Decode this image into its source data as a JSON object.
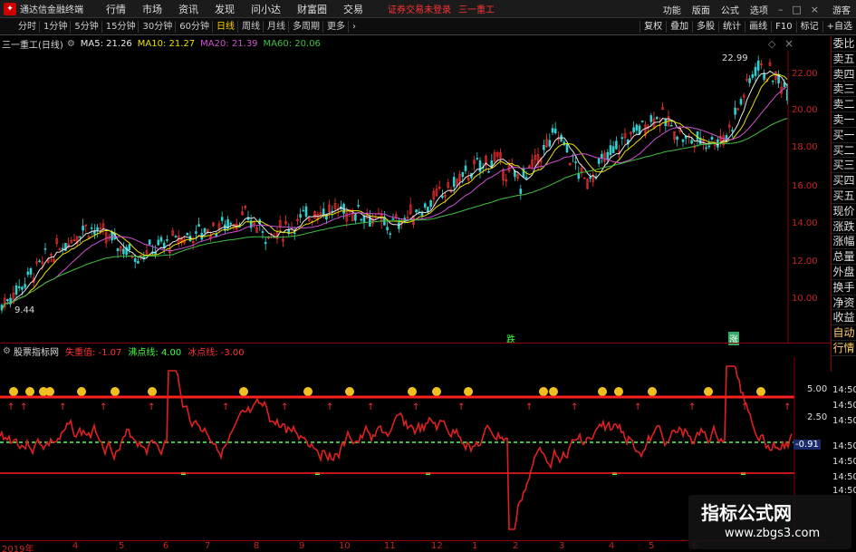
{
  "app": {
    "title": "通达信金融终端",
    "menu": [
      "行情",
      "市场",
      "资讯",
      "发现",
      "问小达",
      "财富圈",
      "交易"
    ],
    "broker_status": "证券交易未登录",
    "stock_title": "三一重工",
    "right_menu": [
      "功能",
      "版面",
      "公式",
      "选项"
    ],
    "guest": "游客"
  },
  "toolbar": {
    "periods": [
      "分时",
      "1分钟",
      "5分钟",
      "15分钟",
      "30分钟",
      "60分钟",
      "日线",
      "周线",
      "月线",
      "多周期",
      "更多"
    ],
    "active_period": "日线",
    "right_buttons": [
      "复权",
      "叠加",
      "多股",
      "统计",
      "画线",
      "F10",
      "标记",
      "+自选"
    ]
  },
  "ma_line": {
    "stock": "三一重工(日线)",
    "items": [
      {
        "text": "MA5: 21.26",
        "color": "#e8e8e8"
      },
      {
        "text": "MA10: 21.27",
        "color": "#e8e000"
      },
      {
        "text": "MA20: 21.39",
        "color": "#d050d0"
      },
      {
        "text": "MA60: 20.06",
        "color": "#40c040"
      }
    ]
  },
  "price_axis": [
    "22.00",
    "20.00",
    "18.00",
    "16.00",
    "14.00",
    "12.00",
    "10.00"
  ],
  "price_annotations": {
    "high": "22.99",
    "low": "9.44"
  },
  "chart_markers": [
    "跌",
    "涨"
  ],
  "right_panel": [
    "委比",
    "卖五",
    "卖四",
    "卖三",
    "卖二",
    "卖一",
    "买一",
    "买二",
    "买三",
    "买四",
    "买五",
    "现价",
    "涨跌",
    "涨幅",
    "总量",
    "外盘",
    "换手",
    "净资",
    "收益",
    "自动",
    "行情"
  ],
  "indicator": {
    "name": "股票指标网",
    "items": [
      {
        "text": "失重值: -1.07",
        "color": "#ff3333"
      },
      {
        "text": "沸点线: 4.00",
        "color": "#40ff40"
      },
      {
        "text": "冰点线: -3.00",
        "color": "#ff3333"
      }
    ],
    "axis": [
      "5.00",
      "2.50",
      "-0.91"
    ],
    "current_value": "-0.91"
  },
  "time_labels": [
    "14:50",
    "14:50",
    "14:50",
    "14:50",
    "14:50",
    "14:50",
    "14:50"
  ],
  "date_axis": [
    "2019年",
    "4",
    "5",
    "6",
    "7",
    "8",
    "9",
    "10",
    "11",
    "12",
    "1",
    "2",
    "3",
    "4",
    "5",
    "6"
  ],
  "watermark": {
    "title": "指标公式网",
    "url": "www.zbgs3.com"
  }
}
